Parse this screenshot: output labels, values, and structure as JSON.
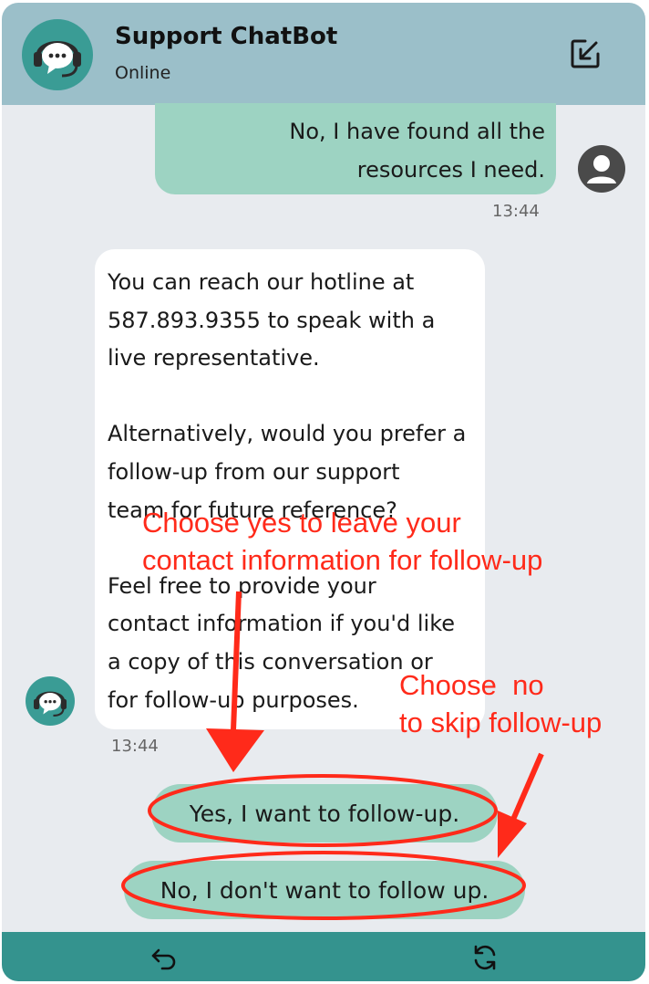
{
  "header": {
    "title": "Support ChatBot",
    "status": "Online"
  },
  "messages": [
    {
      "sender": "user",
      "lines": [
        "No, I have found all the",
        "resources I need."
      ],
      "time": "13:44"
    },
    {
      "sender": "bot",
      "paragraphs": [
        [
          "You can reach our hotline at",
          "587.893.9355 to speak with a",
          "live representative."
        ],
        [
          "Alternatively, would you prefer a",
          "follow-up from our support",
          "team for future reference?"
        ],
        [
          "Feel free to provide your",
          "contact information if you'd like",
          "a copy of this conversation or",
          "for follow-up purposes."
        ]
      ],
      "time": "13:44"
    }
  ],
  "options": {
    "yes": "Yes, I want to follow-up.",
    "no": "No, I don't want to follow up."
  },
  "annotations": {
    "yes_line1": "Choose yes to leave your",
    "yes_line2": "contact information for follow-up",
    "no_line1": "Choose  no",
    "no_line2": "to skip follow-up"
  },
  "icons": {
    "bot_avatar": "chatbot-headset-icon",
    "user_avatar": "user-icon",
    "minimize": "minimize-arrow-icon",
    "back": "undo-arrow-icon",
    "refresh": "refresh-icon"
  },
  "colors": {
    "header": "#9bbfc9",
    "user_bubble": "#9dd3c2",
    "bot_bubble": "#ffffff",
    "footer": "#34938e",
    "annotation": "#ff2a1a"
  }
}
